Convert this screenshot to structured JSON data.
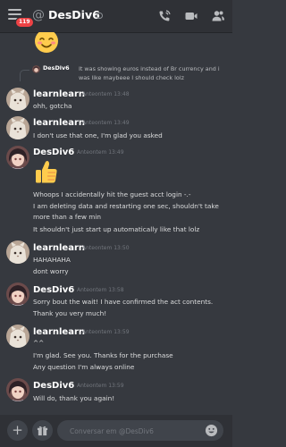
{
  "header": {
    "channel_name": "DesDiv6",
    "badge_count": "119",
    "at_symbol": "@"
  },
  "reply": {
    "author": "DesDiv6",
    "text": "It was showing euros instead of Br currency and i was like maybeee I should check lolz"
  },
  "messages": [
    {
      "author": "learnlearn",
      "author_color": "#ffffff",
      "time": "Anteontem 13:48",
      "lines": [
        "ohh, gotcha"
      ]
    },
    {
      "author": "learnlearn",
      "author_color": "#ffffff",
      "time": "Anteontem 13:49",
      "lines": [
        "I don't use that one, I'm glad you asked"
      ]
    },
    {
      "author": "DesDiv6",
      "author_color": "#ffffff",
      "time": "Anteontem 13:49",
      "lines": [
        "Whoops I accidentally hit the guest acct login -.-",
        "I am deleting data and restarting one sec, shouldn't take",
        "more than a few min",
        "It shouldn't just start up automatically like that lolz"
      ]
    },
    {
      "author": "learnlearn",
      "author_color": "#ffffff",
      "time": "Anteontem 13:50",
      "lines": [
        "HAHAHAHA",
        "dont worry"
      ]
    },
    {
      "author": "DesDiv6",
      "author_color": "#ffffff",
      "time": "Anteontem 13:58",
      "lines": [
        "Sorry bout the wait! I have confirmed the act contents.",
        "Thank you very much!"
      ]
    },
    {
      "author": "learnlearn",
      "author_color": "#ffffff",
      "time": "Anteontem 13:59",
      "lines": [
        "^^",
        "I'm glad. See you. Thanks for the purchase",
        "Any question I'm always online"
      ]
    },
    {
      "author": "DesDiv6",
      "author_color": "#ffffff",
      "time": "Anteontem 13:59",
      "lines": [
        "Will do, thank you again!"
      ]
    }
  ],
  "composer": {
    "placeholder": "Conversar em @DesDiv6",
    "plus": "+"
  },
  "colors": {
    "background": "#36393f",
    "header": "#2f3136",
    "input": "#40444b",
    "mention_badge": "#ed4245"
  }
}
